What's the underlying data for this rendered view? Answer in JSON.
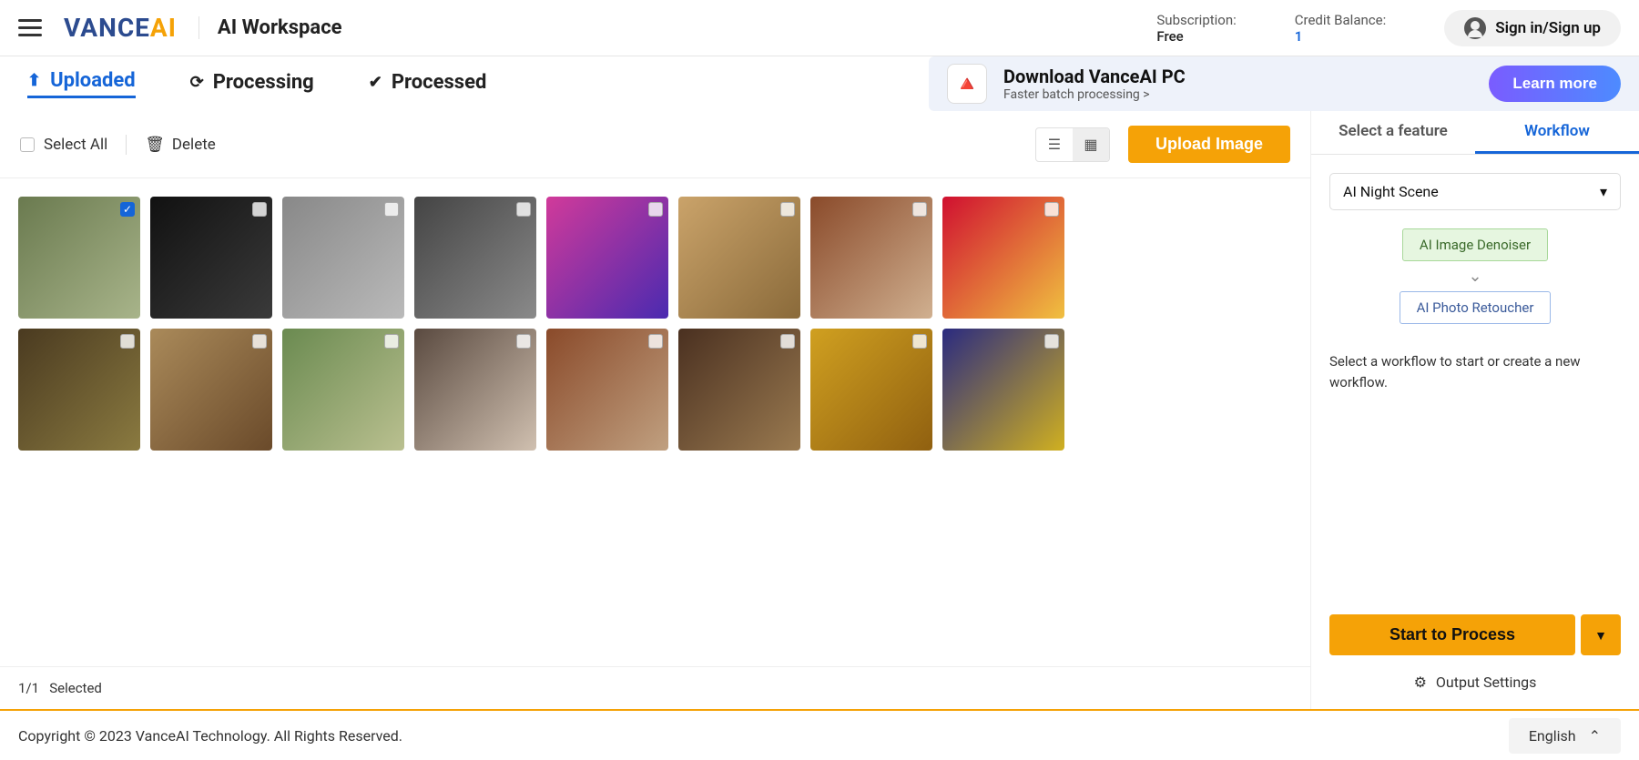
{
  "header": {
    "logo_primary": "VANCE",
    "logo_accent": "AI",
    "page_title": "AI Workspace",
    "subscription_label": "Subscription:",
    "subscription_value": "Free",
    "credit_label": "Credit Balance:",
    "credit_value": "1",
    "signin": "Sign in/Sign up"
  },
  "tabs": {
    "uploaded": "Uploaded",
    "processing": "Processing",
    "processed": "Processed"
  },
  "promo": {
    "title": "Download VanceAI PC",
    "subtitle": "Faster batch processing >",
    "cta": "Learn more"
  },
  "toolbar": {
    "select_all": "Select All",
    "delete": "Delete",
    "upload": "Upload Image"
  },
  "grid": {
    "items": [
      {
        "checked": true,
        "cls": "g0"
      },
      {
        "checked": false,
        "cls": "g1"
      },
      {
        "checked": false,
        "cls": "g2"
      },
      {
        "checked": false,
        "cls": "g3"
      },
      {
        "checked": false,
        "cls": "g4"
      },
      {
        "checked": false,
        "cls": "g5"
      },
      {
        "checked": false,
        "cls": "g6"
      },
      {
        "checked": false,
        "cls": "g7"
      },
      {
        "checked": false,
        "cls": "g8"
      },
      {
        "checked": false,
        "cls": "g9"
      },
      {
        "checked": false,
        "cls": "g10"
      },
      {
        "checked": false,
        "cls": "g11"
      },
      {
        "checked": false,
        "cls": "g12"
      },
      {
        "checked": false,
        "cls": "g13"
      },
      {
        "checked": false,
        "cls": "g14"
      },
      {
        "checked": false,
        "cls": "g15"
      }
    ]
  },
  "status": {
    "count": "1/1",
    "label": "Selected"
  },
  "side": {
    "tab_feature": "Select a feature",
    "tab_workflow": "Workflow",
    "feature_selected": "AI Night Scene",
    "step1": "AI Image Denoiser",
    "step2": "AI Photo Retoucher",
    "hint": "Select a workflow to start or create a new workflow.",
    "process": "Start to Process",
    "output_settings": "Output Settings"
  },
  "footer": {
    "copyright": "Copyright © 2023 VanceAI Technology. All Rights Reserved.",
    "language": "English"
  }
}
